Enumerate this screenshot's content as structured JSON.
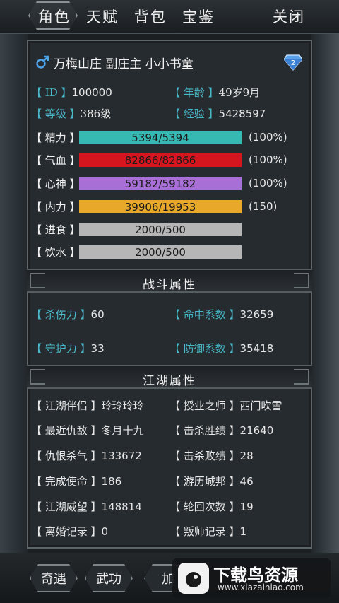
{
  "top_tabs": [
    "角色",
    "天赋",
    "背包",
    "宝鉴",
    "关闭"
  ],
  "header": {
    "title": "万梅山庄 副庄主 小小书童",
    "gender_icon": "male-icon",
    "badge_icon": "diamond-icon"
  },
  "info": {
    "id_label": "【 ID 】",
    "id_value": "100000",
    "age_label": "【 年龄 】",
    "age_value": "49岁9月",
    "level_label": "【 等级 】",
    "level_value": "386级",
    "exp_label": "【 经验 】",
    "exp_value": "5428597"
  },
  "bars": [
    {
      "label": "【 精力 】",
      "text": "5394/5394",
      "fill": 1.0,
      "color": "#36b9b3",
      "pct": "(100%)"
    },
    {
      "label": "【 气血 】",
      "text": "82866/82866",
      "fill": 1.0,
      "color": "#d5161f",
      "pct": "(100%)"
    },
    {
      "label": "【 心神 】",
      "text": "59182/59182",
      "fill": 1.0,
      "color": "#a86fd6",
      "pct": "(100%)"
    },
    {
      "label": "【 内力 】",
      "text": "39906/19953",
      "fill": 1.0,
      "color": "#e8a82a",
      "pct": "(150)"
    },
    {
      "label": "【 进食 】",
      "text": "2000/500",
      "fill": 1.0,
      "color": "#b6b6b6",
      "pct": ""
    },
    {
      "label": "【 饮水 】",
      "text": "2000/500",
      "fill": 1.0,
      "color": "#b6b6b6",
      "pct": ""
    }
  ],
  "combat": {
    "title": "战斗属性",
    "kill_label": "【 杀伤力 】",
    "kill_value": "60",
    "hit_label": "【 命中系数 】",
    "hit_value": "32659",
    "guard_label": "【 守护力 】",
    "guard_value": "33",
    "defense_label": "【 防御系数 】",
    "defense_value": "35418"
  },
  "jianghu": {
    "title": "江湖属性",
    "rows": [
      {
        "l_label": "【 江湖伴侣 】",
        "l_value": "玲玲玲玲",
        "r_label": "【 授业之师 】",
        "r_value": "西门吹雪"
      },
      {
        "l_label": "【 最近仇敌 】",
        "l_value": "冬月十九",
        "r_label": "【 击杀胜绩 】",
        "r_value": "21640"
      },
      {
        "l_label": "【 仇恨杀气 】",
        "l_value": "133672",
        "r_label": "【 击杀败绩 】",
        "r_value": "28"
      },
      {
        "l_label": "【 完成使命 】",
        "l_value": "186",
        "r_label": "【 游历城邦 】",
        "r_value": "46"
      },
      {
        "l_label": "【 江湖威望 】",
        "l_value": "148814",
        "r_label": "【 轮回次数 】",
        "r_value": "19"
      },
      {
        "l_label": "【 离婚记录 】",
        "l_value": "0",
        "r_label": "【 叛师记录 】",
        "r_value": "1"
      }
    ]
  },
  "bottom_tabs": [
    "奇遇",
    "武功",
    "加"
  ],
  "watermark": {
    "title": "下载鸟资源",
    "url": "www.xiazainiao.com"
  }
}
